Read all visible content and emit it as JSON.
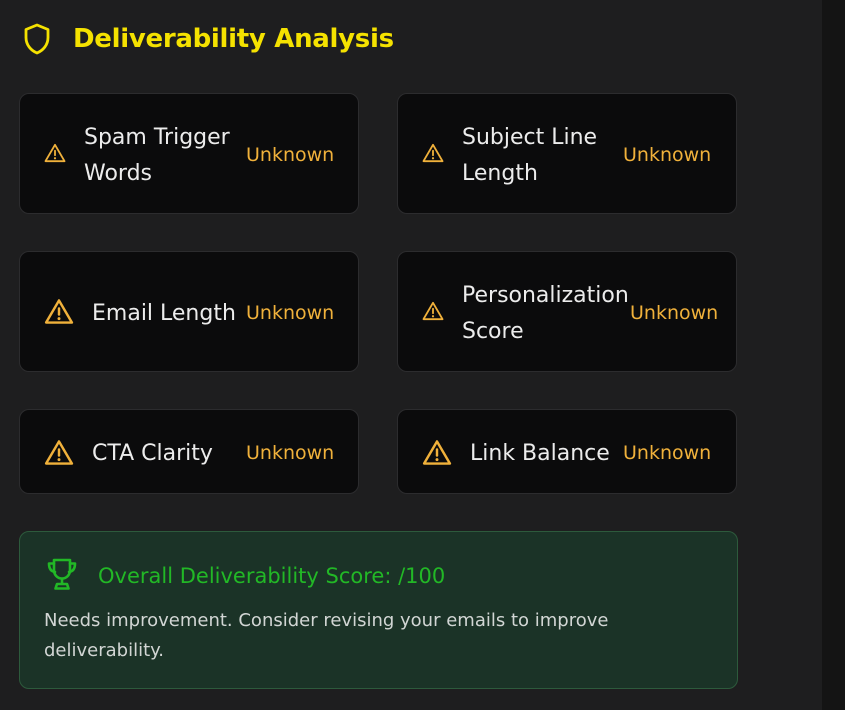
{
  "header": {
    "title": "Deliverability Analysis",
    "icon": "shield-icon"
  },
  "checks": [
    {
      "label_lines": [
        "Spam Trigger",
        "Words"
      ],
      "status": "Unknown",
      "icon": "warning-icon"
    },
    {
      "label_lines": [
        "Subject Line",
        "Length"
      ],
      "status": "Unknown",
      "icon": "warning-icon"
    },
    {
      "label_lines": [
        "Email Length"
      ],
      "status": "Unknown",
      "icon": "warning-icon"
    },
    {
      "label_lines": [
        "Personalization",
        "Score"
      ],
      "status": "Unknown",
      "icon": "warning-icon"
    },
    {
      "label_lines": [
        "CTA Clarity"
      ],
      "status": "Unknown",
      "icon": "warning-icon"
    },
    {
      "label_lines": [
        "Link Balance"
      ],
      "status": "Unknown",
      "icon": "warning-icon"
    }
  ],
  "score": {
    "title": "Overall Deliverability Score: /100",
    "description": "Needs improvement. Consider revising your emails to improve deliverability.",
    "icon": "trophy-icon"
  },
  "colors": {
    "title": "#f5e200",
    "status": "#f0b13b",
    "score_title": "#22b826",
    "score_bg": "#1b3327",
    "card_bg": "#0b0b0c",
    "page_bg": "#1e1e1f"
  }
}
